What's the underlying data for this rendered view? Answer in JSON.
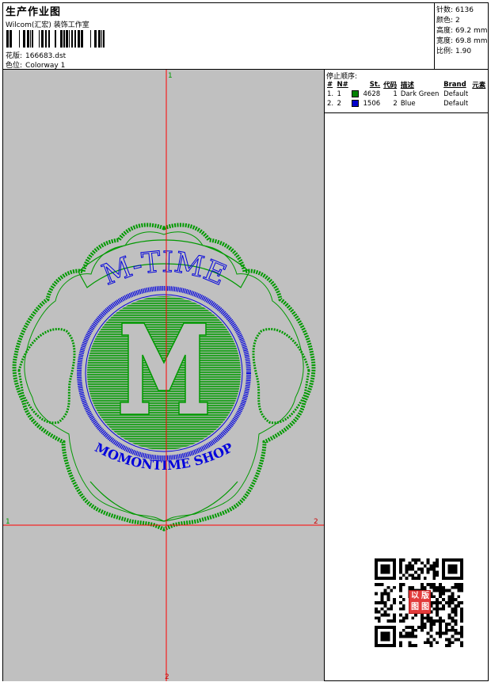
{
  "header": {
    "title": "生产作业图",
    "company": "Wilcom(汇宏) 装饰工作室",
    "design_label": "花版:",
    "design_value": "166683.dst",
    "colorway_label": "色位:",
    "colorway_value": "Colorway 1"
  },
  "stats": [
    {
      "label": "针数:",
      "value": "6136"
    },
    {
      "label": "颜色:",
      "value": "2"
    },
    {
      "label": "高度:",
      "value": "69.2 mm"
    },
    {
      "label": "宽度:",
      "value": "69.8 mm"
    },
    {
      "label": "比例:",
      "value": "1.90"
    }
  ],
  "stop_sequence": {
    "title": "停止顺序:",
    "headers": [
      "#",
      "N#",
      "St.",
      "代码",
      "描述",
      "Brand",
      "元素"
    ],
    "rows": [
      {
        "index": "1.",
        "needle": "1",
        "stitches": "4628",
        "code": "1",
        "desc": "Dark Green",
        "brand": "Default",
        "color": "#008000"
      },
      {
        "index": "2.",
        "needle": "2",
        "stitches": "1506",
        "code": "2",
        "desc": "Blue",
        "brand": "Default",
        "color": "#0000cc"
      }
    ]
  },
  "canvas": {
    "axis_top_label": "1",
    "axis_left_label": "1",
    "axis_right_label": "2",
    "axis_bottom_label": "2",
    "design_top_text": "M-TIME",
    "design_center_text": "M",
    "design_bottom_text": "MOMONTIME SHOP",
    "colors": {
      "green": "#009900",
      "blue": "#0000dd",
      "guide": "#ff0000",
      "bg": "#c0c0c0"
    }
  },
  "stamp": {
    "chars": [
      "以",
      "图",
      "图",
      "版"
    ]
  }
}
